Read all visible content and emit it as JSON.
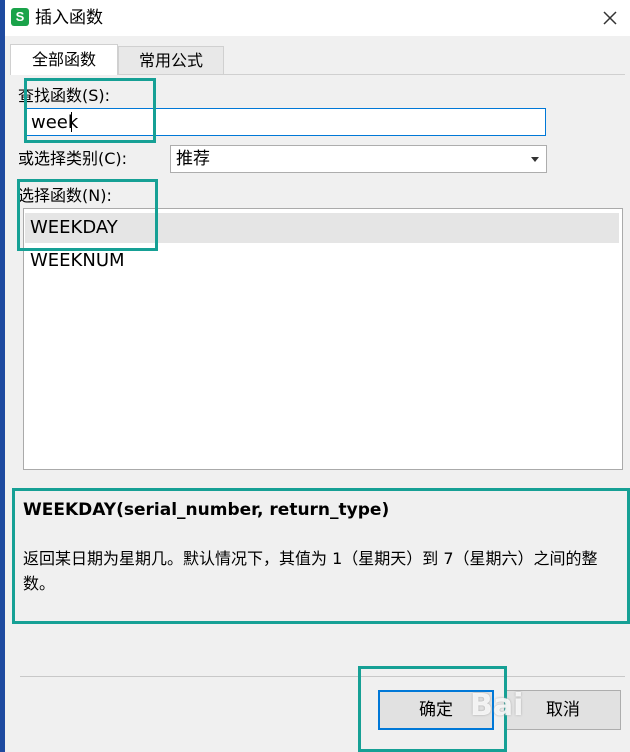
{
  "window": {
    "app_icon_letter": "S",
    "title": "插入函数"
  },
  "tabs": [
    {
      "label": "全部函数",
      "active": true
    },
    {
      "label": "常用公式",
      "active": false
    }
  ],
  "search": {
    "label": "查找函数(S):",
    "value": "week"
  },
  "category": {
    "label": "或选择类别(C):",
    "selected": "推荐"
  },
  "functions": {
    "label": "选择函数(N):",
    "items": [
      {
        "name": "WEEKDAY",
        "selected": true
      },
      {
        "name": "WEEKNUM",
        "selected": false
      }
    ]
  },
  "description": {
    "signature": "WEEKDAY(serial_number, return_type)",
    "text": "返回某日期为星期几。默认情况下，其值为 1（星期天）到 7（星期六）之间的整数。"
  },
  "buttons": {
    "ok": "确定",
    "cancel": "取消"
  },
  "watermark": "Bai",
  "colors": {
    "highlight": "#16a095",
    "accent": "#0078d7",
    "app_icon": "#1aa34a"
  }
}
